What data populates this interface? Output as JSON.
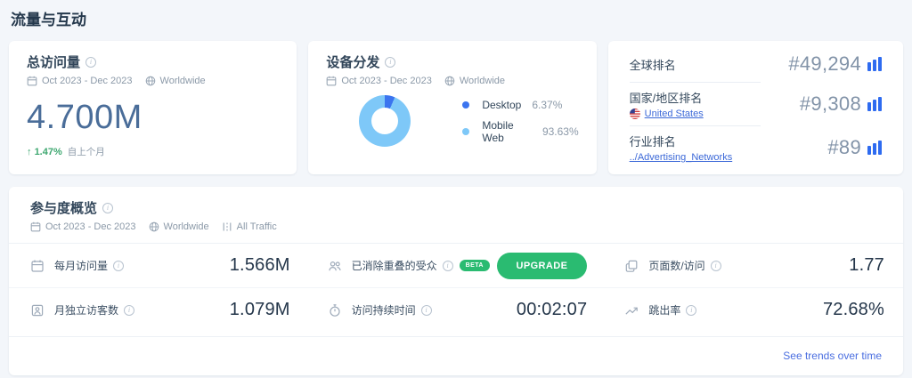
{
  "page": {
    "title": "流量与互动"
  },
  "icons": {
    "info": "i",
    "up_arrow": "↑"
  },
  "colors": {
    "accent_blue": "#2e6bf0",
    "link_blue": "#3b68d8",
    "trends_link_blue": "#4a6ee0",
    "positive_green": "#3fa871",
    "upgrade_green": "#2abb71",
    "big_value_blue": "#4a6d99",
    "donut_desktop": "#3b74ef",
    "donut_mobile": "#7ec8f8"
  },
  "cards": {
    "total_visits": {
      "title": "总访问量",
      "date_range": "Oct 2023 - Dec 2023",
      "region": "Worldwide",
      "value": "4.700M",
      "change": "1.47%",
      "change_direction": "up",
      "change_label": "自上个月"
    },
    "device": {
      "title": "设备分发",
      "date_range": "Oct 2023 - Dec 2023",
      "region": "Worldwide",
      "legend": [
        {
          "label": "Desktop",
          "value": "6.37%"
        },
        {
          "label": "Mobile Web",
          "value": "93.63%"
        }
      ]
    },
    "rankings": {
      "rows": [
        {
          "label": "全球排名",
          "value": "#49,294"
        },
        {
          "label": "国家/地区排名",
          "link": "United States",
          "value": "#9,308"
        },
        {
          "label": "行业排名",
          "link": "../Advertising_Networks",
          "value": "#89"
        }
      ]
    },
    "engagement": {
      "title": "参与度概览",
      "date_range": "Oct 2023 - Dec 2023",
      "region": "Worldwide",
      "traffic_filter": "All Traffic",
      "metrics": [
        {
          "label": "每月访问量",
          "value": "1.566M"
        },
        {
          "label": "已消除重叠的受众",
          "badge": "BETA",
          "button_label": "UPGRADE"
        },
        {
          "label": "页面数/访问",
          "value": "1.77"
        },
        {
          "label": "月独立访客数",
          "value": "1.079M"
        },
        {
          "label": "访问持续时间",
          "value": "00:02:07"
        },
        {
          "label": "跳出率",
          "value": "72.68%"
        }
      ],
      "footer_link": "See trends over time"
    }
  },
  "chart_data": {
    "type": "pie",
    "title": "设备分发",
    "labels": [
      "Desktop",
      "Mobile Web"
    ],
    "values": [
      6.37,
      93.63
    ],
    "colors": [
      "#3b74ef",
      "#7ec8f8"
    ],
    "legend_position": "right",
    "donut": true
  }
}
